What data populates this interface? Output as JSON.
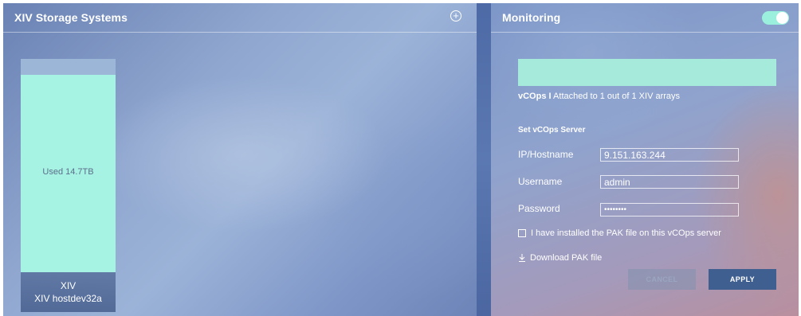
{
  "left_panel": {
    "title": "XIV Storage Systems",
    "add_icon": "plus-circle-icon",
    "storage_card": {
      "used_label": "Used 14.7TB",
      "used_fraction": 0.925,
      "type": "XIV",
      "name": "XIV hostdev32a"
    }
  },
  "right_panel": {
    "title": "Monitoring",
    "toggle_on": true,
    "status": {
      "product": "vCOps",
      "separator": "I",
      "text": "Attached to 1 out of 1 XIV arrays"
    },
    "section_title": "Set vCOps Server",
    "fields": {
      "ip_label": "IP/Hostname",
      "ip_value": "9.151.163.244",
      "username_label": "Username",
      "username_value": "admin",
      "password_label": "Password",
      "password_value": "••••••••"
    },
    "checkbox_label": "I have installed the PAK file on this vCOps server",
    "download_label": "Download PAK file",
    "download_icon": "download-arrow-icon",
    "cancel_label": "CANCEL",
    "apply_label": "APPLY"
  },
  "colors": {
    "accent": "#a6f3e3",
    "apply_button": "#3f5f91"
  }
}
